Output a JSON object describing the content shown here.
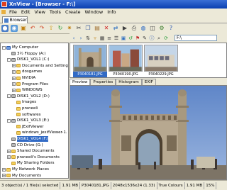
{
  "window": {
    "title": "XnView - [Browser - F:\\]"
  },
  "menu": {
    "items": [
      "File",
      "Edit",
      "View",
      "Tools",
      "Create",
      "Window",
      "Info"
    ]
  },
  "tabs": {
    "browser": "Browser"
  },
  "path": {
    "value": "F:\\"
  },
  "tree": [
    {
      "label": "My Computer",
      "icon": "computer",
      "level": 0,
      "exp": "-"
    },
    {
      "label": "3½ Floppy (A:)",
      "icon": "drive",
      "level": 1,
      "exp": ""
    },
    {
      "label": "DISK1_VOL1 (C:)",
      "icon": "drive",
      "level": 1,
      "exp": "-"
    },
    {
      "label": "Documents and Settings",
      "icon": "folder",
      "level": 2,
      "exp": "+"
    },
    {
      "label": "dosgames",
      "icon": "folder",
      "level": 2,
      "exp": "+"
    },
    {
      "label": "NVIDIA",
      "icon": "folder",
      "level": 2,
      "exp": "+"
    },
    {
      "label": "Program Files",
      "icon": "folder",
      "level": 2,
      "exp": "+"
    },
    {
      "label": "WINDOWS",
      "icon": "folder",
      "level": 2,
      "exp": "+"
    },
    {
      "label": "DISK1_VOL2 (D:)",
      "icon": "drive",
      "level": 1,
      "exp": "-"
    },
    {
      "label": "Images",
      "icon": "folder",
      "level": 2,
      "exp": ""
    },
    {
      "label": "praneeli",
      "icon": "folder",
      "level": 2,
      "exp": ""
    },
    {
      "label": "softwares",
      "icon": "folder",
      "level": 2,
      "exp": ""
    },
    {
      "label": "DISK1_VOL3 (E:)",
      "icon": "drive",
      "level": 1,
      "exp": "-"
    },
    {
      "label": "JExifViewer",
      "icon": "folder",
      "level": 2,
      "exp": ""
    },
    {
      "label": "windows_jexifViewer-1.",
      "icon": "folder",
      "level": 2,
      "exp": ""
    },
    {
      "label": "DISK1_VOL4 (F:)",
      "icon": "drive",
      "level": 1,
      "exp": "",
      "selected": true
    },
    {
      "label": "CD Drive (G:)",
      "icon": "drive",
      "level": 1,
      "exp": ""
    },
    {
      "label": "Shared Documents",
      "icon": "folder",
      "level": 1,
      "exp": "+"
    },
    {
      "label": "praneeli's Documents",
      "icon": "folder",
      "level": 1,
      "exp": "+"
    },
    {
      "label": "My Sharing Folders",
      "icon": "folder",
      "level": 1,
      "exp": ""
    },
    {
      "label": "My Network Places",
      "icon": "folder",
      "level": 0,
      "exp": "+"
    },
    {
      "label": "My Documents",
      "icon": "folder",
      "level": 0,
      "exp": "+"
    }
  ],
  "thumbnails": [
    {
      "caption": "P3040181.JPG",
      "selected": true
    },
    {
      "caption": "P3040190.JPG",
      "selected": false
    },
    {
      "caption": "P3040229.JPG",
      "selected": false
    }
  ],
  "preview_tabs": [
    "Preview",
    "Properties",
    "Histogram",
    "EXIF"
  ],
  "status": {
    "objects": "3 object(s) / 1 file(s) selected",
    "size": "1.91 MB",
    "filename": "P3040181.JPG",
    "dims": "2048x1536x24 (1.33)",
    "colours": "True Colours",
    "mem": "1.91 MB",
    "zoom": "15%"
  },
  "colors": {
    "titlebar": "#0a3fb0",
    "selection": "#316ac5"
  }
}
